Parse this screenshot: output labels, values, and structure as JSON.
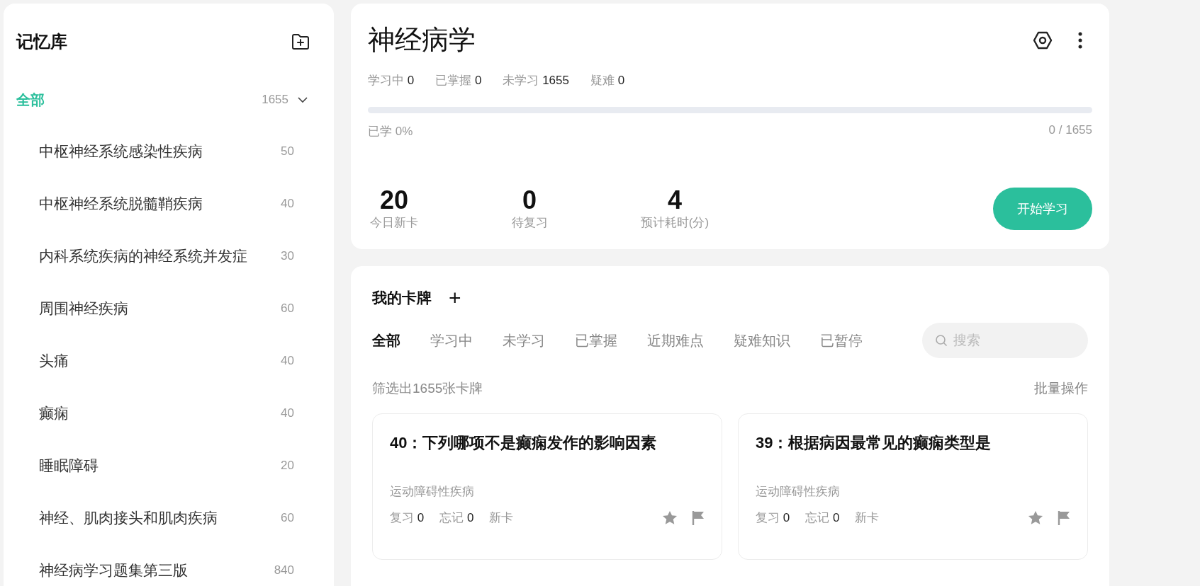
{
  "sidebar": {
    "title": "记忆库",
    "all": {
      "label": "全部",
      "count": "1655",
      "selected": true,
      "expanded": true
    },
    "items": [
      {
        "label": "中枢神经系统感染性疾病",
        "count": "50",
        "selected": false
      },
      {
        "label": "中枢神经系统脱髓鞘疾病",
        "count": "40",
        "selected": false
      },
      {
        "label": "内科系统疾病的神经系统并发症",
        "count": "30",
        "selected": false
      },
      {
        "label": "周围神经疾病",
        "count": "60",
        "selected": false
      },
      {
        "label": "头痛",
        "count": "40",
        "selected": false
      },
      {
        "label": "癫痫",
        "count": "40",
        "selected": false
      },
      {
        "label": "睡眠障碍",
        "count": "20",
        "selected": false
      },
      {
        "label": "神经、肌肉接头和肌肉疾病",
        "count": "60",
        "selected": false
      },
      {
        "label": "神经病学习题集第三版",
        "count": "840",
        "selected": false
      }
    ]
  },
  "deck": {
    "title": "神经病学",
    "stats": [
      {
        "label": "学习中",
        "value": "0"
      },
      {
        "label": "已掌握",
        "value": "0"
      },
      {
        "label": "未学习",
        "value": "1655"
      },
      {
        "label": "疑难",
        "value": "0"
      }
    ],
    "progress": {
      "level": 0,
      "label": "已学 0%",
      "reading": "0 / 1655"
    },
    "summary": [
      {
        "value": "20",
        "label": "今日新卡"
      },
      {
        "value": "0",
        "label": "待复习"
      },
      {
        "value": "4",
        "label": "预计耗时(分)"
      }
    ],
    "start_button": "开始学习"
  },
  "cards_panel": {
    "title": "我的卡牌",
    "add": "+",
    "tabs": [
      {
        "label": "全部",
        "selected": true
      },
      {
        "label": "学习中",
        "selected": false
      },
      {
        "label": "未学习",
        "selected": false
      },
      {
        "label": "已掌握",
        "selected": false
      },
      {
        "label": "近期难点",
        "selected": false
      },
      {
        "label": "疑难知识",
        "selected": false
      },
      {
        "label": "已暂停",
        "selected": false
      }
    ],
    "search": {
      "placeholder": "搜索"
    },
    "filter_text": "筛选出1655张卡牌",
    "batch": "批量操作",
    "cards": [
      {
        "title": "40：下列哪项不是癫痫发作的影响因素",
        "category": "运动障碍性疾病",
        "review_label": "复习",
        "review": "0",
        "forget_label": "忘记",
        "forget": "0",
        "status": "新卡",
        "starred": false,
        "flagged": false
      },
      {
        "title": "39：根据病因最常见的癫痫类型是",
        "category": "运动障碍性疾病",
        "review_label": "复习",
        "review": "0",
        "forget_label": "忘记",
        "forget": "0",
        "status": "新卡",
        "starred": false,
        "flagged": false
      }
    ]
  }
}
